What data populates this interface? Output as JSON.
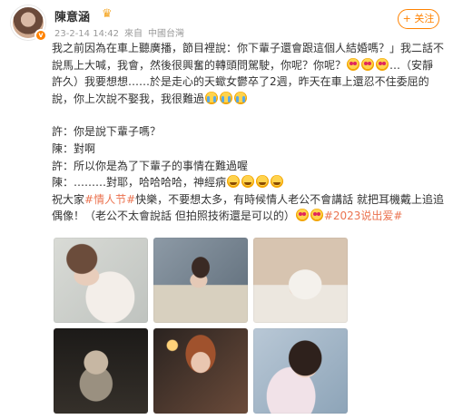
{
  "post": {
    "username": "陳意涵",
    "date": "23-2-14 14:42",
    "source": "來自",
    "location": "中國台灣",
    "follow_label": "+ 关注",
    "paragraph1_a": "我之前因為在車上聽廣播，節目裡說：你下輩子還會跟這個人結婚嗎？」我二話不說馬上大喊，我會，然後很興奮的轉頭問駕駛，你呢？你呢？",
    "paragraph1_b": "…（安靜許久）我要想想……於是走心的天蠍女鬱卒了2週，昨天在車上還忍不住委屈的說，你上次說不娶我，我很難過",
    "dialogue": [
      {
        "text": "許：你是說下輩子嗎？"
      },
      {
        "text": "陳：對啊"
      },
      {
        "text": "許：所以你是為了下輩子的事情在難過喔"
      },
      {
        "text": "陳：………對耶，哈哈哈哈，神經病"
      }
    ],
    "closing_a": "祝大家",
    "hashtag1": "#情人节#",
    "closing_b": "快樂，不要想太多，有時候情人老公不會講話 就把耳機戴上追追偶像！（老公不太會說話 但拍照技術還是可以的）",
    "hashtag2": "#2023说出爱#"
  },
  "icons": {
    "avatar_badge": "v-badge",
    "vip": "crown-icon",
    "emoji_heart_eyes": "heart-eyes-emoji",
    "emoji_cry": "crying-emoji",
    "emoji_laugh": "laughing-emoji"
  },
  "colors": {
    "accent": "#ff8200",
    "hashtag": "#eb7350",
    "meta": "#999999"
  },
  "photos": [
    {
      "name": "photo-woman-with-flowers"
    },
    {
      "name": "photo-woman-with-paper-bag"
    },
    {
      "name": "photo-woman-on-bed"
    },
    {
      "name": "photo-man-in-dark-room"
    },
    {
      "name": "photo-woman-with-drink"
    },
    {
      "name": "photo-woman-selfie"
    }
  ]
}
